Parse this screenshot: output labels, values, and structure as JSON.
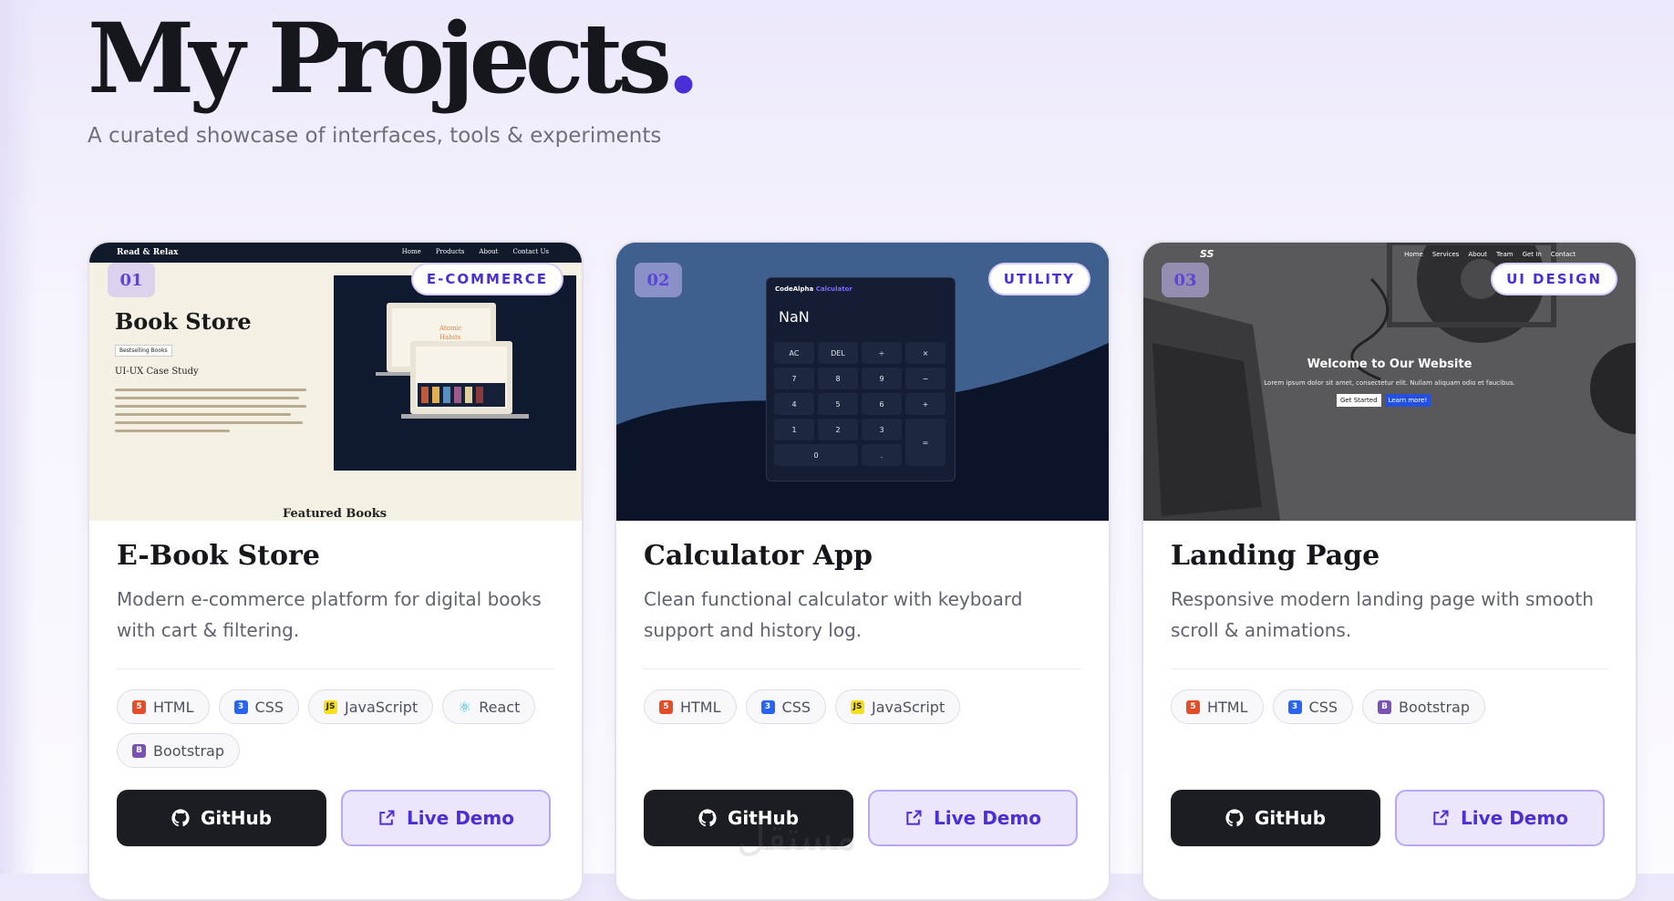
{
  "header": {
    "title": "My Projects",
    "title_dot": ".",
    "subtitle": "A curated showcase of interfaces, tools & experiments"
  },
  "colors": {
    "accent": "#4a2fd6",
    "dark_button": "#1b1d22",
    "demo_button_bg": "#ece6fd"
  },
  "projects": [
    {
      "number": "01",
      "category": "E-COMMERCE",
      "title": "E-Book Store",
      "description": "Modern e-commerce platform for digital books with cart & filtering.",
      "tags": [
        {
          "label": "HTML",
          "icon": "html5-icon"
        },
        {
          "label": "CSS",
          "icon": "css3-icon"
        },
        {
          "label": "JavaScript",
          "icon": "javascript-icon"
        },
        {
          "label": "React",
          "icon": "react-icon"
        },
        {
          "label": "Bootstrap",
          "icon": "bootstrap-icon"
        }
      ],
      "github_label": "GitHub",
      "demo_label": "Live Demo",
      "preview": {
        "brand": "Read & Relax",
        "nav": [
          "Home",
          "Products",
          "About",
          "Contact Us"
        ],
        "heading": "Book Store",
        "pill": "Bestselling Books",
        "subheading": "UI-UX Case Study",
        "featured": "Featured Books"
      }
    },
    {
      "number": "02",
      "category": "UTILITY",
      "title": "Calculator App",
      "description": "Clean functional calculator with keyboard support and history log.",
      "tags": [
        {
          "label": "HTML",
          "icon": "html5-icon"
        },
        {
          "label": "CSS",
          "icon": "css3-icon"
        },
        {
          "label": "JavaScript",
          "icon": "javascript-icon"
        }
      ],
      "github_label": "GitHub",
      "demo_label": "Live Demo",
      "preview": {
        "app_name": "CodeAlpha",
        "app_name_accent": "Calculator",
        "display": "NaN",
        "keys": [
          "AC",
          "DEL",
          "÷",
          "×",
          "7",
          "8",
          "9",
          "−",
          "4",
          "5",
          "6",
          "+",
          "1",
          "2",
          "3",
          "=",
          "0",
          "."
        ]
      }
    },
    {
      "number": "03",
      "category": "UI DESIGN",
      "title": "Landing Page",
      "description": "Responsive modern landing page with smooth scroll & animations.",
      "tags": [
        {
          "label": "HTML",
          "icon": "html5-icon"
        },
        {
          "label": "CSS",
          "icon": "css3-icon"
        },
        {
          "label": "Bootstrap",
          "icon": "bootstrap-icon"
        }
      ],
      "github_label": "GitHub",
      "demo_label": "Live Demo",
      "preview": {
        "logo": "SS",
        "nav": [
          "Home",
          "Services",
          "About",
          "Team",
          "Get In",
          "Contact"
        ],
        "heading": "Welcome to Our Website",
        "text": "Lorem ipsum dolor sit amet, consectetur elit. Nullam aliquam odio et faucibus.",
        "btn_primary": "Get Started",
        "btn_secondary": "Learn more!"
      }
    }
  ],
  "watermark": "مستقل"
}
